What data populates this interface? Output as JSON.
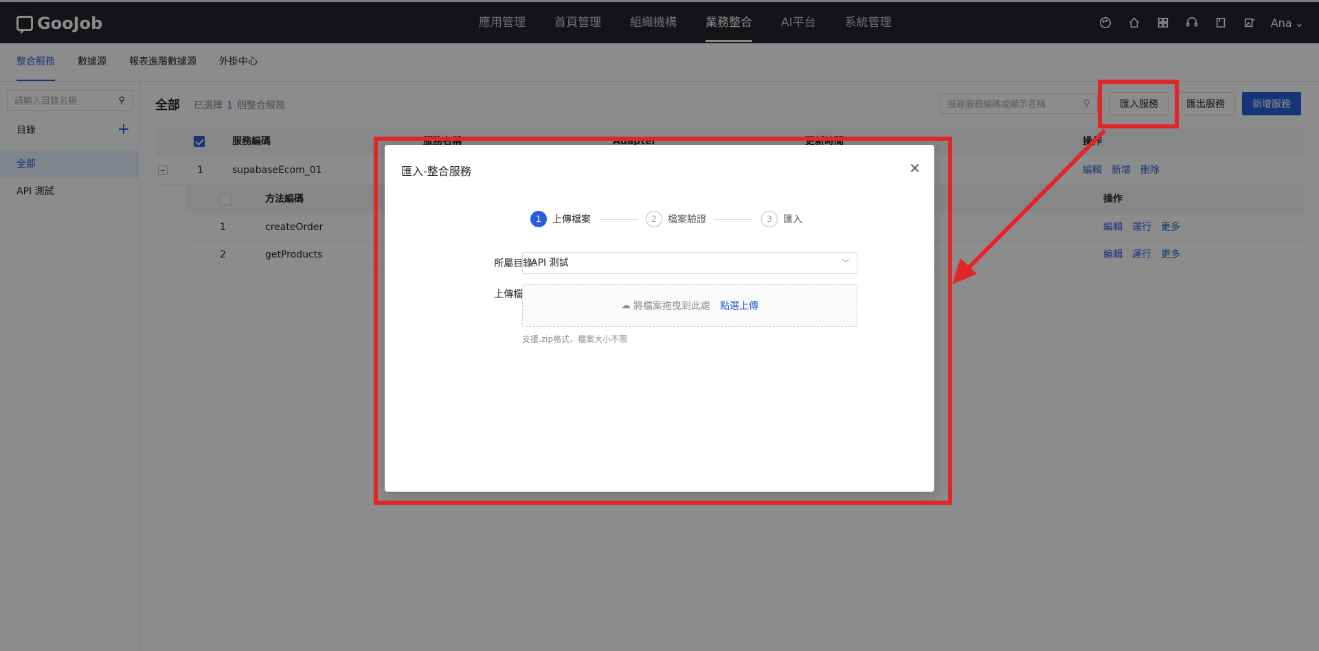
{
  "app": {
    "logo": "GooJob",
    "user": "Ana"
  },
  "nav": [
    {
      "label": "應用管理"
    },
    {
      "label": "首頁管理"
    },
    {
      "label": "組織機構"
    },
    {
      "label": "業務整合"
    },
    {
      "label": "AI平台"
    },
    {
      "label": "系統管理"
    }
  ],
  "subnav": [
    {
      "label": "整合服務"
    },
    {
      "label": "數據源"
    },
    {
      "label": "報表進階數據源"
    },
    {
      "label": "外掛中心"
    }
  ],
  "sidebar": {
    "search_placeholder": "請輸入目錄名稱",
    "heading": "目錄",
    "items": [
      {
        "label": "全部"
      },
      {
        "label": "API 測試"
      }
    ]
  },
  "main": {
    "title": "全部",
    "selected_prefix": "已選擇",
    "selected_count": "1",
    "selected_suffix": "個整合服務",
    "search_placeholder": "搜尋服務編碼或顯示名稱",
    "import_label": "匯入服務",
    "export_label": "匯出服務",
    "add_label": "新增服務",
    "columns": {
      "code": "服務編碼",
      "name": "服務名稱",
      "adapter": "Adapter",
      "updated": "更新時間",
      "ops": "操作"
    },
    "service_row": {
      "index": "1",
      "code": "supabaseEcom_01",
      "op_edit": "編輯",
      "op_add": "新增",
      "op_delete": "刪除"
    },
    "method_columns": {
      "code": "方法編碼",
      "ops": "操作"
    },
    "methods": [
      {
        "index": "1",
        "code": "createOrder",
        "op_edit": "編輯",
        "op_run": "運行",
        "op_more": "更多"
      },
      {
        "index": "2",
        "code": "getProducts",
        "op_edit": "編輯",
        "op_run": "運行",
        "op_more": "更多"
      }
    ]
  },
  "modal": {
    "title": "匯入-整合服務",
    "steps": [
      {
        "num": "1",
        "label": "上傳檔案"
      },
      {
        "num": "2",
        "label": "檔案驗證"
      },
      {
        "num": "3",
        "label": "匯入"
      }
    ],
    "dir_label": "所屬目錄:",
    "dir_value": "API 測試",
    "file_label": "上傳檔案:",
    "drop_text": "將檔案拖曳到此處",
    "upload_link": "點選上傳",
    "hint": "支援.zip格式，檔案大小不限"
  },
  "colors": {
    "accent": "#2b5fd9",
    "annotation": "#e22626",
    "topbar": "#24262b"
  }
}
